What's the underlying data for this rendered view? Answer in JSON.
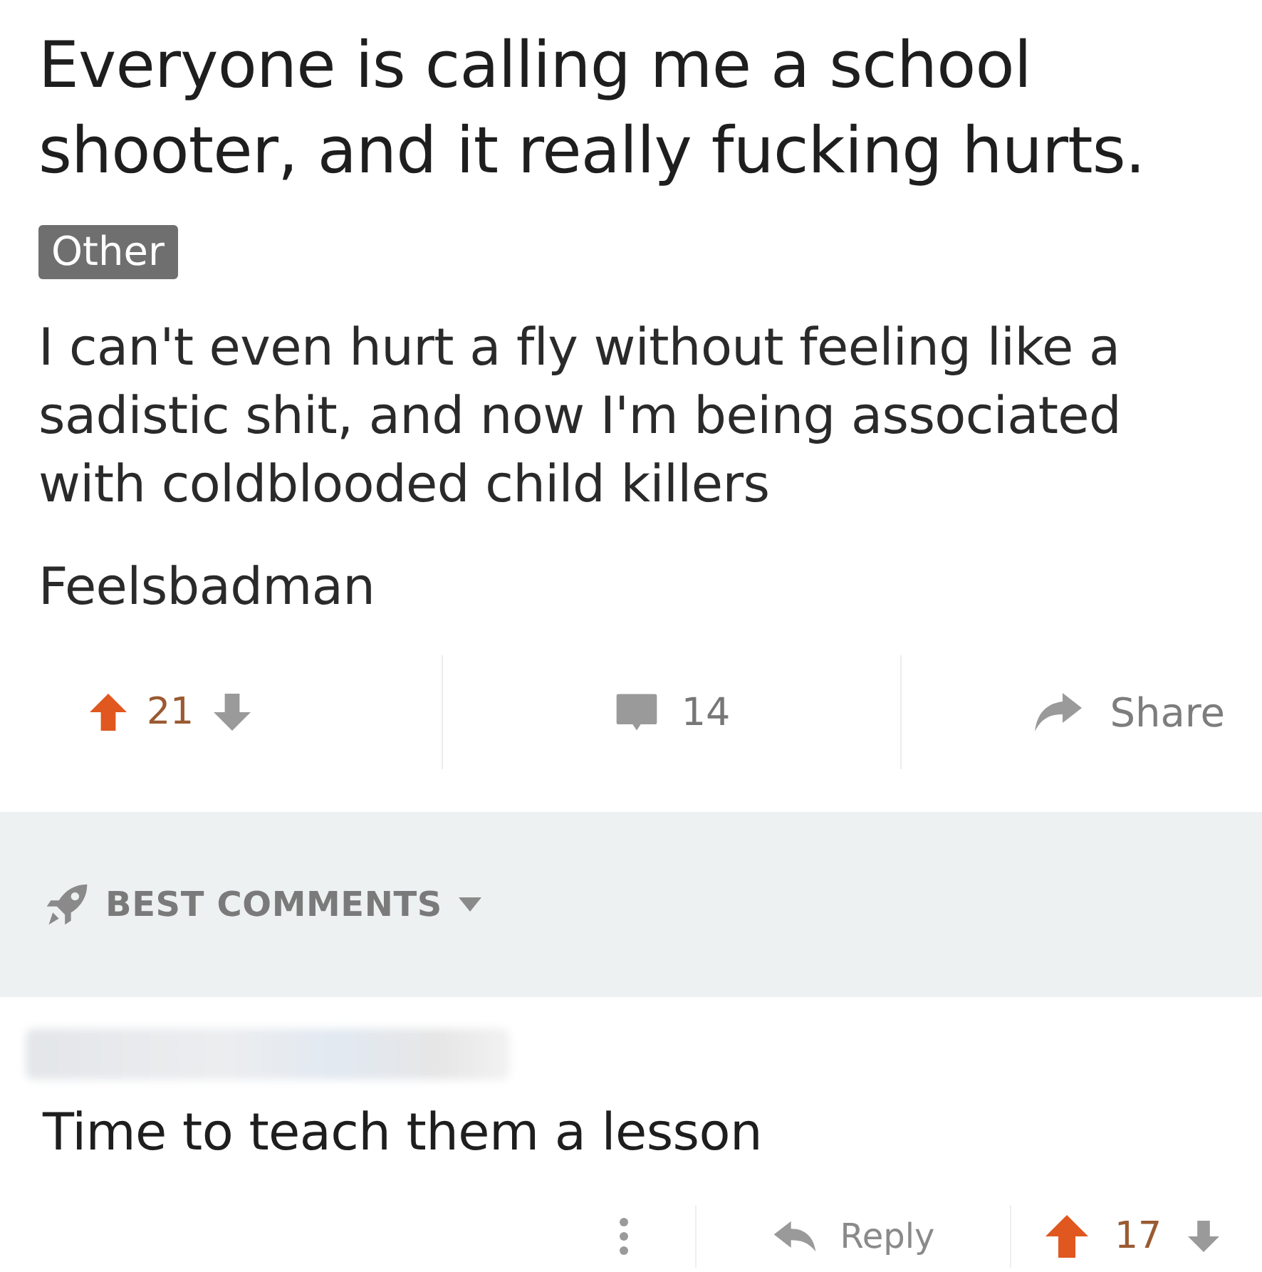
{
  "post": {
    "title": "Everyone is calling me a school shooter, and it really fucking hurts.",
    "flair": "Other",
    "paragraphs": [
      "I can't even hurt a fly without feeling like a sadistic shit, and now I'm being associated with coldblooded child killers",
      "Feelsbadman"
    ]
  },
  "actions": {
    "upvoted": true,
    "score": "21",
    "comments": "14",
    "share": "Share"
  },
  "sort": {
    "label": "BEST COMMENTS"
  },
  "comments": [
    {
      "body": "Time to teach them a lesson",
      "reply": "Reply",
      "score": "17",
      "upvoted": true
    }
  ]
}
